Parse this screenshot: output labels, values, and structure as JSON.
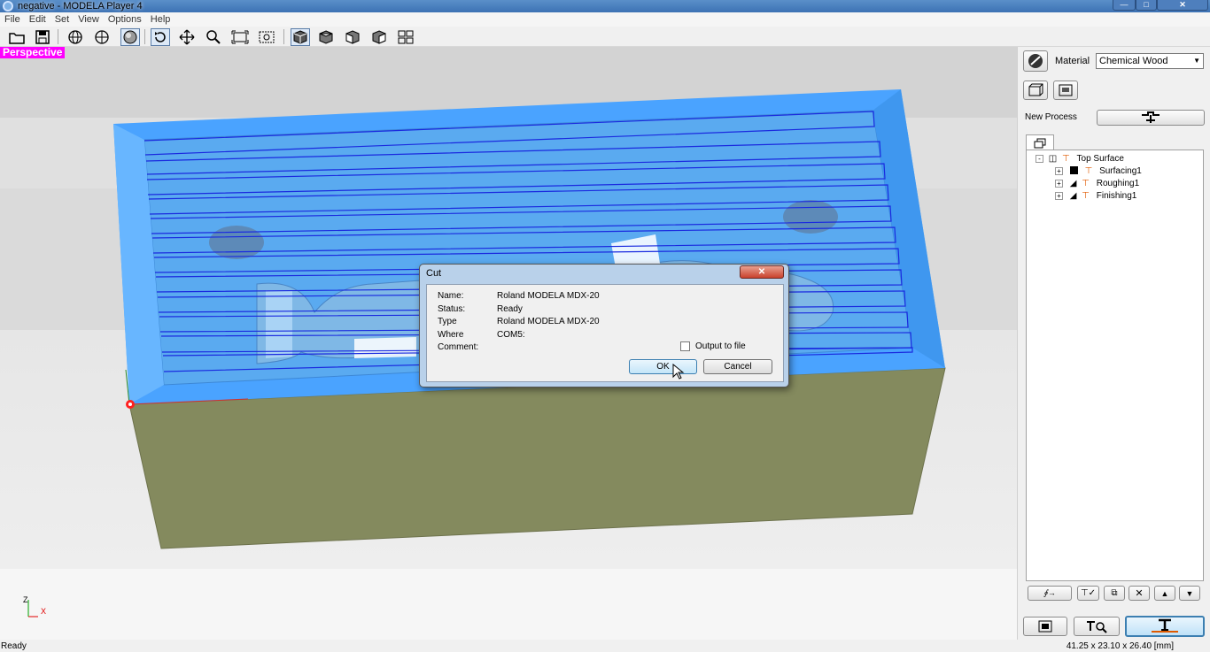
{
  "window": {
    "title": "negative - MODELA Player 4"
  },
  "menu": [
    "File",
    "Edit",
    "Set",
    "View",
    "Options",
    "Help"
  ],
  "toolbar": {
    "icons": [
      "open-icon",
      "save-icon",
      "globe-icon",
      "half-globe-icon",
      "sphere-icon",
      "rotate-icon",
      "move-icon",
      "zoom-icon",
      "fit-icon",
      "zoom-region-icon",
      "view-iso-icon",
      "view-top-icon",
      "view-front-icon",
      "view-side-icon",
      "view-grid-icon"
    ]
  },
  "viewport": {
    "label": "Perspective",
    "axis_z": "Z",
    "axis_x": "X"
  },
  "side": {
    "material_label": "Material",
    "material_value": "Chemical Wood",
    "new_process_label": "New Process",
    "tree": {
      "root": "Top Surface",
      "children": [
        "Surfacing1",
        "Roughing1",
        "Finishing1"
      ]
    }
  },
  "dialog": {
    "title": "Cut",
    "name_label": "Name:",
    "name_value": "Roland MODELA MDX-20",
    "status_label": "Status:",
    "status_value": "Ready",
    "type_label": "Type",
    "type_value": "Roland MODELA MDX-20",
    "where_label": "Where",
    "where_value": "COM5:",
    "comment_label": "Comment:",
    "output_label": "Output to file",
    "output_checked": false,
    "ok_label": "OK",
    "cancel_label": "Cancel"
  },
  "status": {
    "left": "Ready",
    "right": "41.25 x 23.10 x 26.40 [mm]"
  },
  "colors": {
    "part_blue": "#4aa3ff",
    "stock_green": "#848a5e",
    "toolpath": "#1a2adf",
    "perspective_bg": "#ff00ff"
  }
}
